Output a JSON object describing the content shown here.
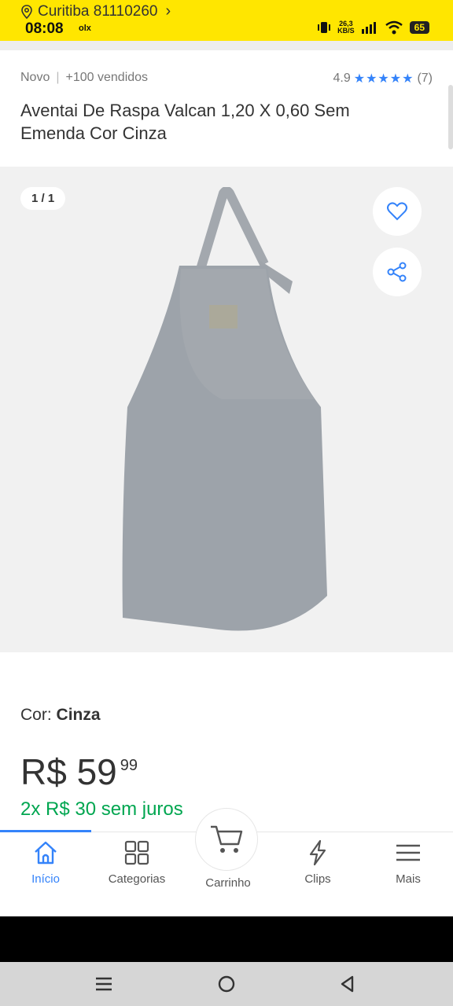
{
  "status_bar": {
    "location": "Curitiba 81110260",
    "time": "08:08",
    "app_badge": "olx",
    "net_speed_value": "26,3",
    "net_speed_unit": "KB/S",
    "battery": "65"
  },
  "product": {
    "condition": "Novo",
    "sold": "+100 vendidos",
    "rating": "4.9",
    "stars": "★★★★★",
    "reviews": "(7)",
    "title": "Aventai De Raspa Valcan 1,20 X 0,60 Sem Emenda Cor Cinza"
  },
  "gallery": {
    "counter": "1 / 1"
  },
  "details": {
    "color_label": "Cor:",
    "color_value": "Cinza",
    "price_main": "R$ 59",
    "price_cents": "99",
    "installments": "2x R$ 30 sem juros"
  },
  "bottom_nav": {
    "items": [
      {
        "label": "Início",
        "icon": "home-icon",
        "active": true
      },
      {
        "label": "Categorias",
        "icon": "grid-icon",
        "active": false
      },
      {
        "label": "Carrinho",
        "icon": "cart-icon",
        "active": false
      },
      {
        "label": "Clips",
        "icon": "lightning-icon",
        "active": false
      },
      {
        "label": "Mais",
        "icon": "menu-icon",
        "active": false
      }
    ]
  },
  "colors": {
    "brand_yellow": "#ffe600",
    "accent_blue": "#3483fa",
    "success_green": "#00a650",
    "product_gray": "#9aa0a8"
  }
}
